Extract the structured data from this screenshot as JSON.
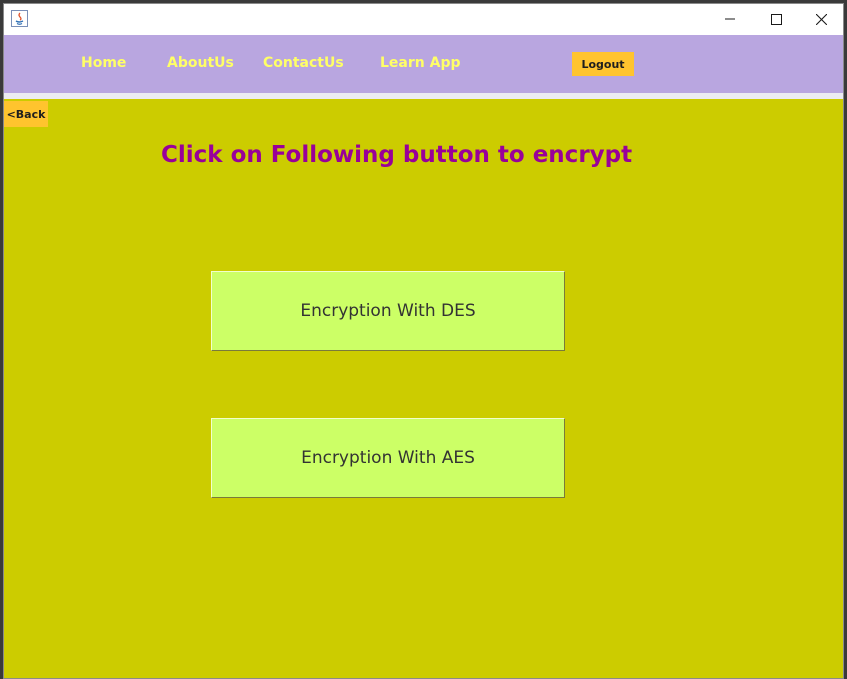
{
  "window": {
    "icon": "java-app-icon",
    "controls": {
      "minimize": "minimize-icon",
      "maximize": "maximize-icon",
      "close": "close-icon"
    }
  },
  "nav": {
    "home": "Home",
    "about": "AboutUs",
    "contact": "ContactUs",
    "learn": "Learn App",
    "logout": "Logout"
  },
  "main": {
    "back": "<Back",
    "heading": "Click on Following button to encrypt",
    "buttons": [
      {
        "label": "Encryption With DES"
      },
      {
        "label": "Encryption With AES"
      }
    ]
  },
  "colors": {
    "navbar": "#b9a6e0",
    "nav_text": "#ffff66",
    "accent_button": "#ffc42e",
    "main_background": "#cccc00",
    "heading": "#990099",
    "encrypt_button": "#ccff66"
  }
}
